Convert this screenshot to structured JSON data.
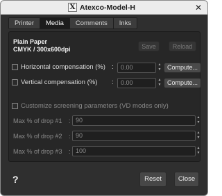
{
  "window": {
    "title": "Atexco-Model-H",
    "app_icon": "X"
  },
  "tabs": [
    {
      "label": "Printer"
    },
    {
      "label": "Media",
      "active": true
    },
    {
      "label": "Comments"
    },
    {
      "label": "Inks"
    }
  ],
  "media": {
    "name": "Plain Paper",
    "resolution": "CMYK / 300x600dpi",
    "save_label": "Save",
    "reload_label": "Reload"
  },
  "compensation": {
    "horizontal": {
      "label": "Horizontal compensation (%)",
      "colon": ":",
      "value": "0.00",
      "checked": false,
      "button": "Compute..."
    },
    "vertical": {
      "label": "Vertical compensation (%)",
      "colon": ":",
      "value": "0.00",
      "checked": false,
      "button": "Compute..."
    }
  },
  "screening": {
    "label": "Customize screening parameters (VD modes only)",
    "checked": false,
    "drops": [
      {
        "label": "Max % of drop #1",
        "colon": ":",
        "value": "90"
      },
      {
        "label": "Max % of drop #2",
        "colon": ":",
        "value": "90"
      },
      {
        "label": "Max % of drop #3",
        "colon": ":",
        "value": "100"
      }
    ]
  },
  "footer": {
    "help": "?",
    "reset_label": "Reset",
    "close_label": "Close"
  },
  "icons": {
    "close": "close-icon",
    "help": "help-icon",
    "stepper_up": "▲",
    "stepper_down": "▼"
  }
}
